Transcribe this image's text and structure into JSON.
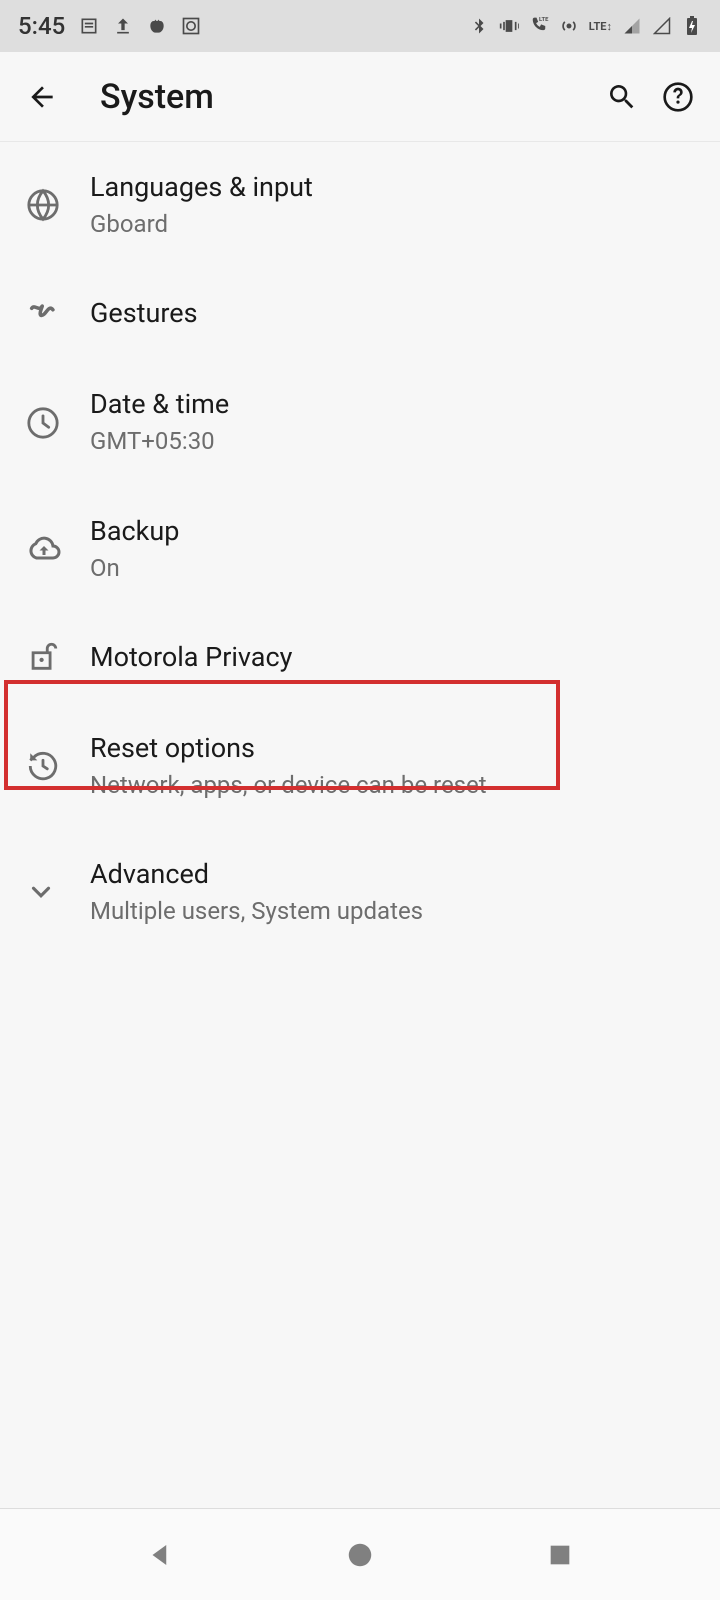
{
  "status_bar": {
    "time": "5:45"
  },
  "header": {
    "title": "System"
  },
  "items": [
    {
      "title": "Languages & input",
      "subtitle": "Gboard"
    },
    {
      "title": "Gestures",
      "subtitle": ""
    },
    {
      "title": "Date & time",
      "subtitle": "GMT+05:30"
    },
    {
      "title": "Backup",
      "subtitle": "On"
    },
    {
      "title": "Motorola Privacy",
      "subtitle": ""
    },
    {
      "title": "Reset options",
      "subtitle": "Network, apps, or device can be reset"
    },
    {
      "title": "Advanced",
      "subtitle": "Multiple users, System updates"
    }
  ]
}
